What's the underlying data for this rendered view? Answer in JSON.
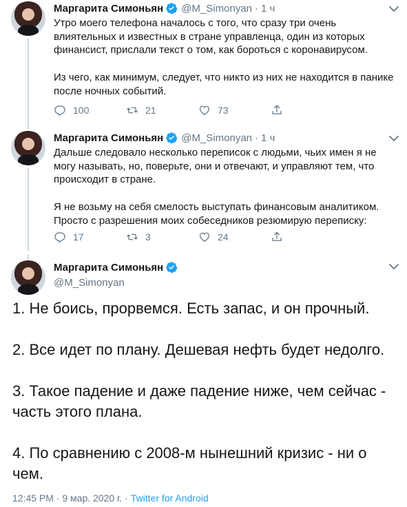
{
  "tweets": [
    {
      "display_name": "Маргарита Симоньян",
      "handle": "@M_Simonyan",
      "dot": "·",
      "time": "1 ч",
      "paragraphs": [
        "Утро моего телефона началось с того, что сразу три очень влиятельных и известных в стране управленца, один из которых финансист, прислали текст о том, как бороться с коронавирусом.",
        "Из чего, как минимум, следует, что никто из них не находится в панике после ночных событий."
      ],
      "replies": "100",
      "retweets": "21",
      "likes": "73"
    },
    {
      "display_name": "Маргарита Симоньян",
      "handle": "@M_Simonyan",
      "dot": "·",
      "time": "1 ч",
      "paragraphs": [
        "Дальше следовало несколько переписок с людьми, чьих имен я не могу называть, но, поверьте, они и отвечают, и управляют тем, что происходит в стране.",
        "Я не возьму на себя смелость выступать финансовым аналитиком. Просто с разрешения моих собеседников резюмирую переписку:"
      ],
      "replies": "17",
      "retweets": "3",
      "likes": "24"
    }
  ],
  "main_tweet": {
    "display_name": "Маргарита Симоньян",
    "handle": "@M_Simonyan",
    "paragraphs": [
      "1. Не боись, прорвемся. Есть запас, и он прочный.",
      "2. Все идет по плану. Дешевая нефть будет недолго.",
      "3. Такое падение и даже падение ниже, чем сейчас - часть этого плана.",
      "4. По сравнению с 2008-м нынешний кризис - ни о чем."
    ],
    "timestamp": "12:45 PM · 9 мар. 2020 г.",
    "separator": " · ",
    "source": "Twitter for Android"
  },
  "icons": {
    "reply": "reply-icon",
    "retweet": "retweet-icon",
    "like": "heart-icon",
    "share": "share-icon",
    "verified": "verified-badge-icon",
    "more": "chevron-down-icon"
  },
  "colors": {
    "accent": "#1da1f2",
    "muted": "#657786",
    "text": "#14171a"
  }
}
